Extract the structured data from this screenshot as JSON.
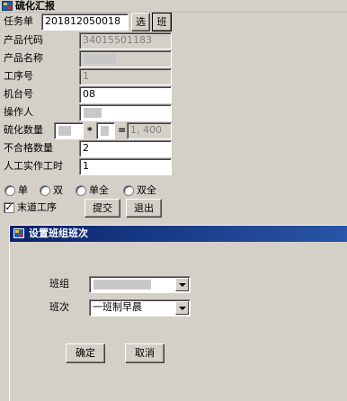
{
  "window": {
    "title": "硫化汇报"
  },
  "form": {
    "task_label": "任务单",
    "task_value": "201812050018",
    "select_button": "选",
    "shift_button": "班",
    "product_code_label": "产品代码",
    "product_code_value": "34015501183",
    "product_name_label": "产品名称",
    "product_name_value": "",
    "process_label": "工序号",
    "process_value": "1",
    "machine_label": "机台号",
    "machine_value": "08",
    "operator_label": "操作人",
    "operator_value": "",
    "vulc_qty_label": "硫化数量",
    "vulc_qty_a": "",
    "multiply_sign": "*",
    "vulc_qty_b": "",
    "equals_sign": "=",
    "vulc_qty_total": "1, 400",
    "defect_label": "不合格数量",
    "defect_value": "2",
    "labor_label": "人工实作工时",
    "labor_value": "1"
  },
  "options": {
    "radio_single": "单",
    "radio_double": "双",
    "radio_single_full": "单全",
    "radio_double_full": "双全",
    "last_process_label": "末道工序",
    "last_process_checked": true,
    "last_process_mark": "✓",
    "submit_button": "提交",
    "exit_button": "退出"
  },
  "dialog": {
    "title": "设置班组班次",
    "team_label": "班组",
    "team_value": "",
    "shift_label": "班次",
    "shift_value": "一班制早晨",
    "ok_button": "确定",
    "cancel_button": "取消"
  }
}
